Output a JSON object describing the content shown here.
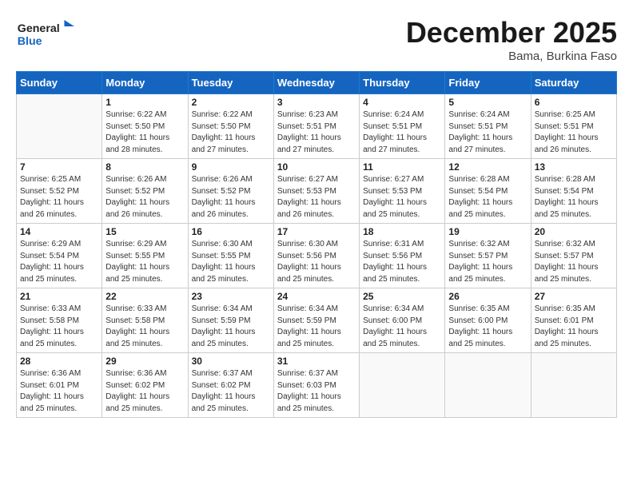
{
  "header": {
    "logo_line1": "General",
    "logo_line2": "Blue",
    "month": "December 2025",
    "location": "Bama, Burkina Faso"
  },
  "weekdays": [
    "Sunday",
    "Monday",
    "Tuesday",
    "Wednesday",
    "Thursday",
    "Friday",
    "Saturday"
  ],
  "weeks": [
    [
      {
        "day": "",
        "detail": ""
      },
      {
        "day": "1",
        "detail": "Sunrise: 6:22 AM\nSunset: 5:50 PM\nDaylight: 11 hours\nand 28 minutes."
      },
      {
        "day": "2",
        "detail": "Sunrise: 6:22 AM\nSunset: 5:50 PM\nDaylight: 11 hours\nand 27 minutes."
      },
      {
        "day": "3",
        "detail": "Sunrise: 6:23 AM\nSunset: 5:51 PM\nDaylight: 11 hours\nand 27 minutes."
      },
      {
        "day": "4",
        "detail": "Sunrise: 6:24 AM\nSunset: 5:51 PM\nDaylight: 11 hours\nand 27 minutes."
      },
      {
        "day": "5",
        "detail": "Sunrise: 6:24 AM\nSunset: 5:51 PM\nDaylight: 11 hours\nand 27 minutes."
      },
      {
        "day": "6",
        "detail": "Sunrise: 6:25 AM\nSunset: 5:51 PM\nDaylight: 11 hours\nand 26 minutes."
      }
    ],
    [
      {
        "day": "7",
        "detail": "Sunrise: 6:25 AM\nSunset: 5:52 PM\nDaylight: 11 hours\nand 26 minutes."
      },
      {
        "day": "8",
        "detail": "Sunrise: 6:26 AM\nSunset: 5:52 PM\nDaylight: 11 hours\nand 26 minutes."
      },
      {
        "day": "9",
        "detail": "Sunrise: 6:26 AM\nSunset: 5:52 PM\nDaylight: 11 hours\nand 26 minutes."
      },
      {
        "day": "10",
        "detail": "Sunrise: 6:27 AM\nSunset: 5:53 PM\nDaylight: 11 hours\nand 26 minutes."
      },
      {
        "day": "11",
        "detail": "Sunrise: 6:27 AM\nSunset: 5:53 PM\nDaylight: 11 hours\nand 25 minutes."
      },
      {
        "day": "12",
        "detail": "Sunrise: 6:28 AM\nSunset: 5:54 PM\nDaylight: 11 hours\nand 25 minutes."
      },
      {
        "day": "13",
        "detail": "Sunrise: 6:28 AM\nSunset: 5:54 PM\nDaylight: 11 hours\nand 25 minutes."
      }
    ],
    [
      {
        "day": "14",
        "detail": "Sunrise: 6:29 AM\nSunset: 5:54 PM\nDaylight: 11 hours\nand 25 minutes."
      },
      {
        "day": "15",
        "detail": "Sunrise: 6:29 AM\nSunset: 5:55 PM\nDaylight: 11 hours\nand 25 minutes."
      },
      {
        "day": "16",
        "detail": "Sunrise: 6:30 AM\nSunset: 5:55 PM\nDaylight: 11 hours\nand 25 minutes."
      },
      {
        "day": "17",
        "detail": "Sunrise: 6:30 AM\nSunset: 5:56 PM\nDaylight: 11 hours\nand 25 minutes."
      },
      {
        "day": "18",
        "detail": "Sunrise: 6:31 AM\nSunset: 5:56 PM\nDaylight: 11 hours\nand 25 minutes."
      },
      {
        "day": "19",
        "detail": "Sunrise: 6:32 AM\nSunset: 5:57 PM\nDaylight: 11 hours\nand 25 minutes."
      },
      {
        "day": "20",
        "detail": "Sunrise: 6:32 AM\nSunset: 5:57 PM\nDaylight: 11 hours\nand 25 minutes."
      }
    ],
    [
      {
        "day": "21",
        "detail": "Sunrise: 6:33 AM\nSunset: 5:58 PM\nDaylight: 11 hours\nand 25 minutes."
      },
      {
        "day": "22",
        "detail": "Sunrise: 6:33 AM\nSunset: 5:58 PM\nDaylight: 11 hours\nand 25 minutes."
      },
      {
        "day": "23",
        "detail": "Sunrise: 6:34 AM\nSunset: 5:59 PM\nDaylight: 11 hours\nand 25 minutes."
      },
      {
        "day": "24",
        "detail": "Sunrise: 6:34 AM\nSunset: 5:59 PM\nDaylight: 11 hours\nand 25 minutes."
      },
      {
        "day": "25",
        "detail": "Sunrise: 6:34 AM\nSunset: 6:00 PM\nDaylight: 11 hours\nand 25 minutes."
      },
      {
        "day": "26",
        "detail": "Sunrise: 6:35 AM\nSunset: 6:00 PM\nDaylight: 11 hours\nand 25 minutes."
      },
      {
        "day": "27",
        "detail": "Sunrise: 6:35 AM\nSunset: 6:01 PM\nDaylight: 11 hours\nand 25 minutes."
      }
    ],
    [
      {
        "day": "28",
        "detail": "Sunrise: 6:36 AM\nSunset: 6:01 PM\nDaylight: 11 hours\nand 25 minutes."
      },
      {
        "day": "29",
        "detail": "Sunrise: 6:36 AM\nSunset: 6:02 PM\nDaylight: 11 hours\nand 25 minutes."
      },
      {
        "day": "30",
        "detail": "Sunrise: 6:37 AM\nSunset: 6:02 PM\nDaylight: 11 hours\nand 25 minutes."
      },
      {
        "day": "31",
        "detail": "Sunrise: 6:37 AM\nSunset: 6:03 PM\nDaylight: 11 hours\nand 25 minutes."
      },
      {
        "day": "",
        "detail": ""
      },
      {
        "day": "",
        "detail": ""
      },
      {
        "day": "",
        "detail": ""
      }
    ]
  ]
}
